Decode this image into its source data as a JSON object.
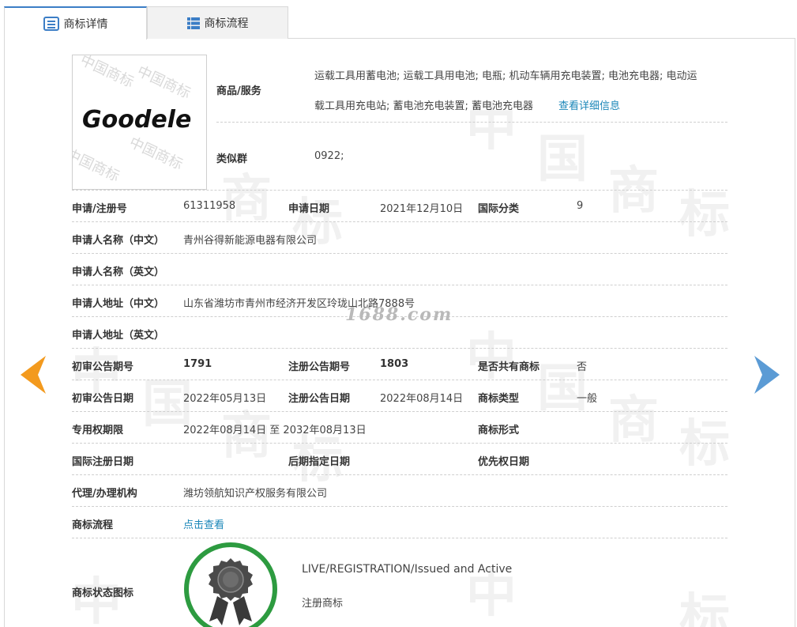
{
  "tabs": [
    {
      "label": "商标详情",
      "icon": "document-list-icon",
      "active": true
    },
    {
      "label": "商标流程",
      "icon": "list-icon",
      "active": false
    }
  ],
  "logo": {
    "text": "Goodele",
    "watermark": "中国商标"
  },
  "goods": {
    "label": "商品/服务",
    "line1": "运载工具用蓄电池; 运载工具用电池; 电瓶; 机动车辆用充电装置; 电池充电器; 电动运",
    "line2": "载工具用充电站; 蓄电池充电装置; 蓄电池充电器",
    "more_link": "查看详细信息"
  },
  "similar_group": {
    "label": "类似群",
    "value": "0922;"
  },
  "reg_number": {
    "label": "申请/注册号",
    "value": "61311958"
  },
  "apply_date": {
    "label": "申请日期",
    "value": "2021年12月10日"
  },
  "intl_class": {
    "label": "国际分类",
    "value": "9"
  },
  "applicant_cn": {
    "label": "申请人名称（中文）",
    "value": "青州谷得新能源电器有限公司"
  },
  "applicant_en": {
    "label": "申请人名称（英文）",
    "value": ""
  },
  "address_cn": {
    "label": "申请人地址（中文）",
    "value": "山东省潍坊市青州市经济开发区玲珑山北路7888号"
  },
  "address_en": {
    "label": "申请人地址（英文）",
    "value": ""
  },
  "site_watermark": "1688.com",
  "prelim_issue": {
    "label": "初审公告期号",
    "value": "1791"
  },
  "reg_issue": {
    "label": "注册公告期号",
    "value": "1803"
  },
  "shared": {
    "label": "是否共有商标",
    "value": "否"
  },
  "prelim_date": {
    "label": "初审公告日期",
    "value": "2022年05月13日"
  },
  "reg_date": {
    "label": "注册公告日期",
    "value": "2022年08月14日"
  },
  "mark_type": {
    "label": "商标类型",
    "value": "一般"
  },
  "exclusive_period": {
    "label": "专用权期限",
    "value": "2022年08月14日 至 2032年08月13日"
  },
  "mark_form": {
    "label": "商标形式",
    "value": ""
  },
  "intl_reg_date": {
    "label": "国际注册日期",
    "value": ""
  },
  "later_date": {
    "label": "后期指定日期",
    "value": ""
  },
  "priority_date": {
    "label": "优先权日期",
    "value": ""
  },
  "agent": {
    "label": "代理/办理机构",
    "value": "潍坊领航知识产权服务有限公司"
  },
  "process": {
    "label": "商标流程",
    "link": "点击查看"
  },
  "status": {
    "label": "商标状态图标",
    "en": "LIVE/REGISTRATION/Issued and Active",
    "cn": "注册商标",
    "ring_color": "#2d9b40"
  },
  "nav": {
    "prev": "prev-arrow-icon",
    "next": "next-arrow-icon"
  },
  "colors": {
    "accent": "#3c7ec6",
    "link": "#1a86b8",
    "prev_arrow": "#f39a1e",
    "next_arrow": "#5b9bd5"
  }
}
